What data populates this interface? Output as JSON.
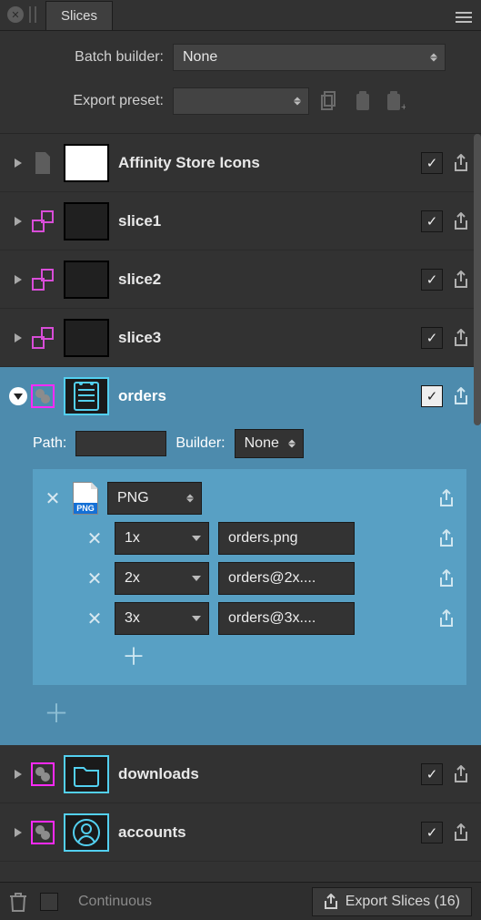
{
  "panel": {
    "title": "Slices"
  },
  "options": {
    "batch_label": "Batch builder:",
    "batch_value": "None",
    "preset_label": "Export preset:",
    "preset_value": ""
  },
  "slices": [
    {
      "name": "Affinity Store Icons",
      "type": "doc",
      "checked": true
    },
    {
      "name": "slice1",
      "type": "slice",
      "checked": true
    },
    {
      "name": "slice2",
      "type": "slice",
      "checked": true
    },
    {
      "name": "slice3",
      "type": "slice",
      "checked": true
    },
    {
      "name": "orders",
      "type": "layer",
      "checked": true,
      "expanded": true
    },
    {
      "name": "downloads",
      "type": "layer",
      "checked": true
    },
    {
      "name": "accounts",
      "type": "layer",
      "checked": true
    }
  ],
  "orders": {
    "path_label": "Path:",
    "path_value": "",
    "builder_label": "Builder:",
    "builder_value": "None",
    "format_label": "PNG",
    "format_badge": "PNG",
    "scales": [
      {
        "scale": "1x",
        "filename": "orders.png"
      },
      {
        "scale": "2x",
        "filename": "orders@2x...."
      },
      {
        "scale": "3x",
        "filename": "orders@3x...."
      }
    ]
  },
  "footer": {
    "continuous_label": "Continuous",
    "continuous_checked": false,
    "export_label": "Export Slices (16)"
  }
}
